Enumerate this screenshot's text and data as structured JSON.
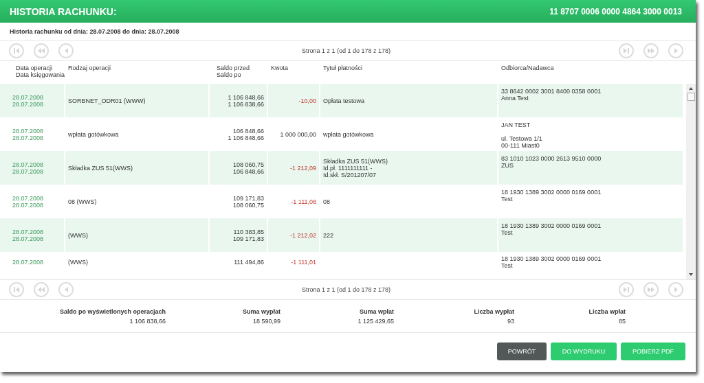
{
  "header": {
    "title": "HISTORIA RACHUNKU:",
    "account": "11 8707 0006 0000 4864 3000 0013"
  },
  "period": "Historia rachunku od dnia: 28.07.2008 do dnia: 28.07.2008",
  "pager_top": {
    "text": "Strona 1 z 1 (od 1 do 178 z 178)",
    "buttons": [
      {
        "kind": "first",
        "disabled": true
      },
      {
        "kind": "rewind",
        "disabled": true
      },
      {
        "kind": "prev",
        "disabled": true
      },
      {
        "kind": "last",
        "disabled": true
      },
      {
        "kind": "forward",
        "disabled": true
      },
      {
        "kind": "next",
        "disabled": true
      }
    ]
  },
  "table": {
    "columns": [
      [
        "Data operacji",
        "Data księgowania"
      ],
      [
        "Rodzaj operacji"
      ],
      [
        "Saldo przed",
        "Saldo po"
      ],
      [
        "Kwota"
      ],
      [
        "Tytuł płatności"
      ],
      [
        "Odbiorca/Nadawca"
      ]
    ],
    "rows": [
      {
        "dates": [
          "28.07.2008",
          "28.07.2008"
        ],
        "type": "SORBNET_ODR01 (WWW)",
        "balance": [
          "1 106 848,66",
          "1 106 838,66"
        ],
        "amount": "-10,00",
        "negative": true,
        "title": [
          "Opłata testowa"
        ],
        "party": [
          "33 8642 0002 3001 8400 0358 0001",
          "Anna Test"
        ]
      },
      {
        "dates": [
          "28.07.2008",
          "28.07.2008"
        ],
        "type": "wpłata gotówkowa",
        "balance": [
          "106 848,66",
          "1 106 848,66"
        ],
        "amount": "1 000 000,00",
        "negative": false,
        "title": [
          "wpłata gotówkowa"
        ],
        "party": [
          "JAN TEST"
        ],
        "address": [
          "ul. Testowa 1/1",
          "00-111 Miast0"
        ]
      },
      {
        "dates": [
          "28.07.2008",
          "28.07.2008"
        ],
        "type": "Składka ZUS 51(WWS)",
        "balance": [
          "108 060,75",
          "106 848,66"
        ],
        "amount": "-1 212,09",
        "negative": true,
        "title": [
          "Składka ZUS 51(WWS)",
          "Id.pł. 1111111111 -",
          "Id.skł. S/201207/07"
        ],
        "party": [
          "83 1010 1023 0000 2613 9510 0000",
          "ZUS"
        ]
      },
      {
        "dates": [
          "28.07.2008",
          "28.07.2008"
        ],
        "type": "08 (WWS)",
        "balance": [
          "109 171,83",
          "108 060,75"
        ],
        "amount": "-1 111,08",
        "negative": true,
        "title": [
          "08"
        ],
        "party": [
          "18 1930 1389 3002 0000 0169 0001",
          "Test"
        ]
      },
      {
        "dates": [
          "28.07.2008",
          "28.07.2008"
        ],
        "type": "(WWS)",
        "balance": [
          "110 383,85",
          "109 171,83"
        ],
        "amount": "-1 212,02",
        "negative": true,
        "title": [
          "222"
        ],
        "party": [
          "18 1930 1389 3002 0000 0169 0001",
          "Test"
        ]
      },
      {
        "dates": [
          "28.07.2008"
        ],
        "type": "(WWS)",
        "balance": [
          "111 494,86"
        ],
        "amount": "-1 111,01",
        "negative": true,
        "title": [],
        "party": [
          "18 1930 1389 3002 0000 0169 0001",
          "Test"
        ]
      }
    ]
  },
  "pager_bottom": {
    "text": "Strona 1 z 1 (od 1 do 178 z 178)",
    "buttons": [
      {
        "kind": "first",
        "disabled": true
      },
      {
        "kind": "rewind",
        "disabled": true
      },
      {
        "kind": "prev",
        "disabled": true
      },
      {
        "kind": "last",
        "disabled": true
      },
      {
        "kind": "forward",
        "disabled": true
      },
      {
        "kind": "next",
        "disabled": true
      }
    ]
  },
  "summary": [
    {
      "label": "Saldo po wyświetlonych operacjach",
      "value": "1 106 838,66"
    },
    {
      "label": "Suma wypłat",
      "value": "18 590,99"
    },
    {
      "label": "Suma wpłat",
      "value": "1 125 429,65"
    },
    {
      "label": "Liczba wypłat",
      "value": "93"
    },
    {
      "label": "Liczba wpłat",
      "value": "85"
    }
  ],
  "buttons": [
    {
      "label": "POWRÓT",
      "kind": "secondary"
    },
    {
      "label": "DO WYDRUKU",
      "kind": "primary"
    },
    {
      "label": "POBIERZ PDF",
      "kind": "primary"
    }
  ]
}
